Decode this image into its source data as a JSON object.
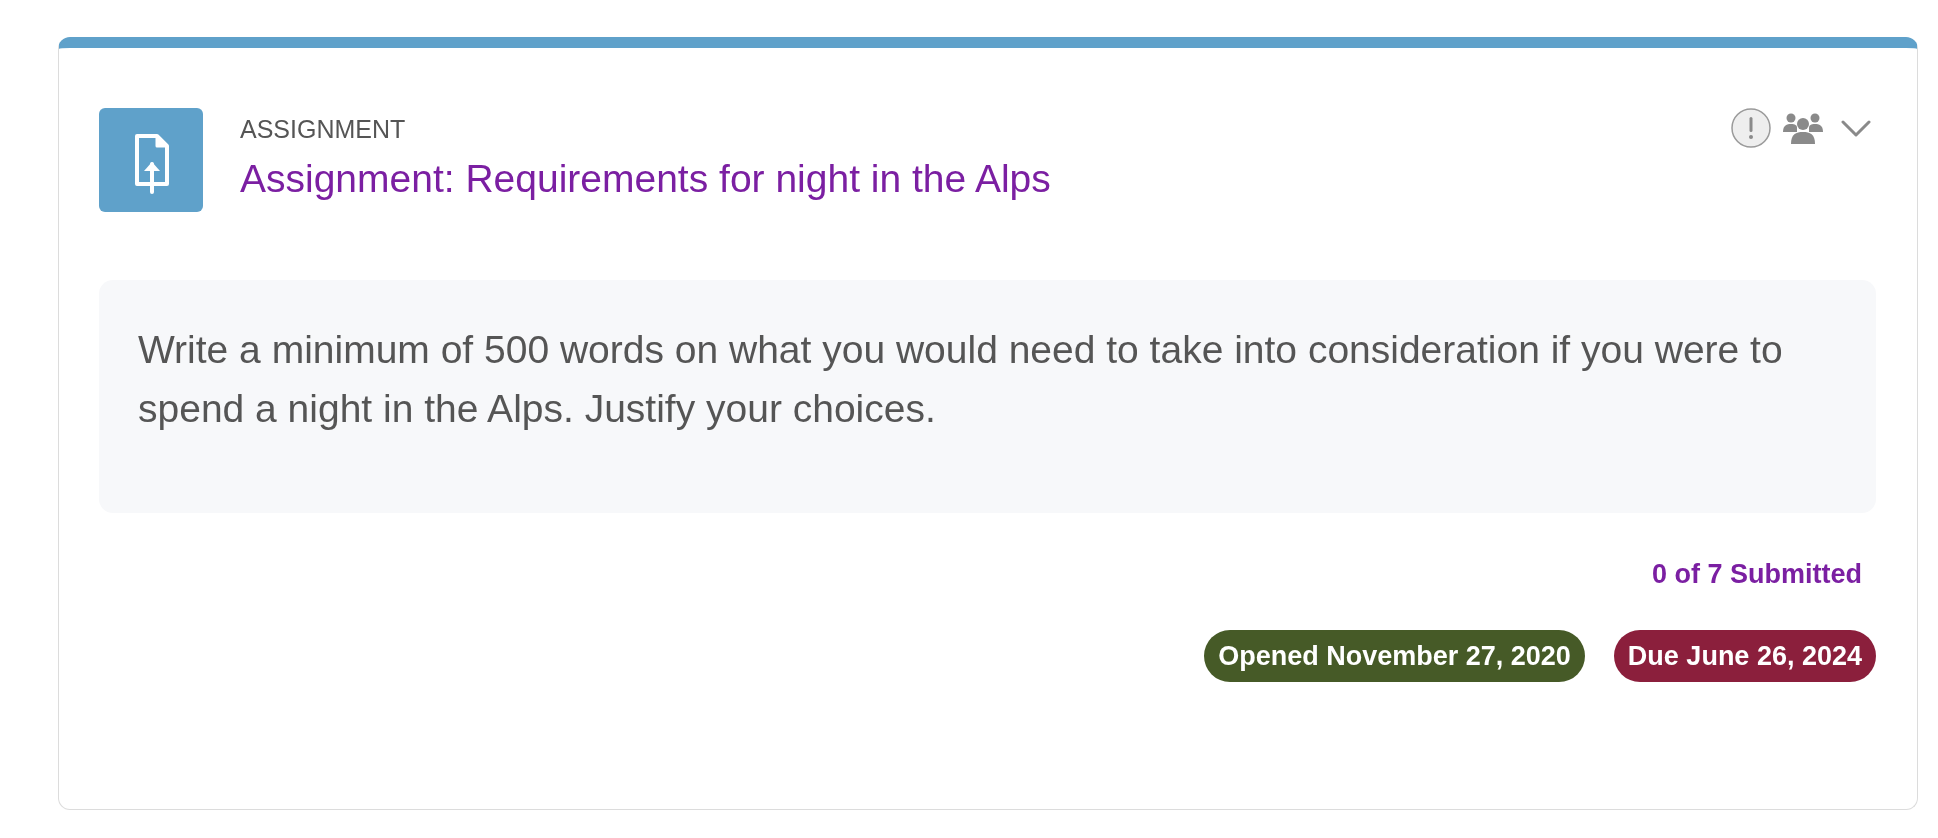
{
  "activity": {
    "type_label": "ASSIGNMENT",
    "title": "Assignment: Requirements for night in the Alps",
    "description": "Write a minimum of 500 words on what you would need to take into consideration if you were to spend a night in the Alps. Justify your choices.",
    "submission_status": "0 of 7 Submitted",
    "dates": [
      {
        "label": "Opened November 27, 2020",
        "color": "#465a27"
      },
      {
        "label": "Due June 26, 2024",
        "color": "#8b1f3c"
      }
    ]
  }
}
